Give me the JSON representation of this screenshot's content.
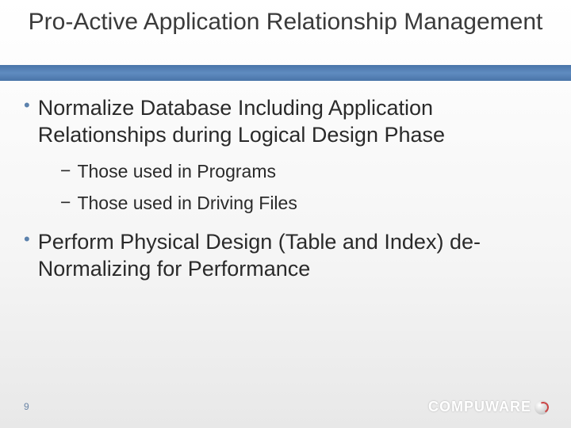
{
  "title": "Pro-Active Application Relationship Management",
  "bullets": [
    {
      "text": "Normalize Database Including Application Relationships during Logical Design Phase",
      "subs": [
        "Those used in Programs",
        "Those used in Driving Files"
      ]
    },
    {
      "text": "Perform Physical Design (Table and Index) de-Normalizing for Performance",
      "subs": []
    }
  ],
  "pageNumber": "9",
  "logo": "COMPUWARE"
}
